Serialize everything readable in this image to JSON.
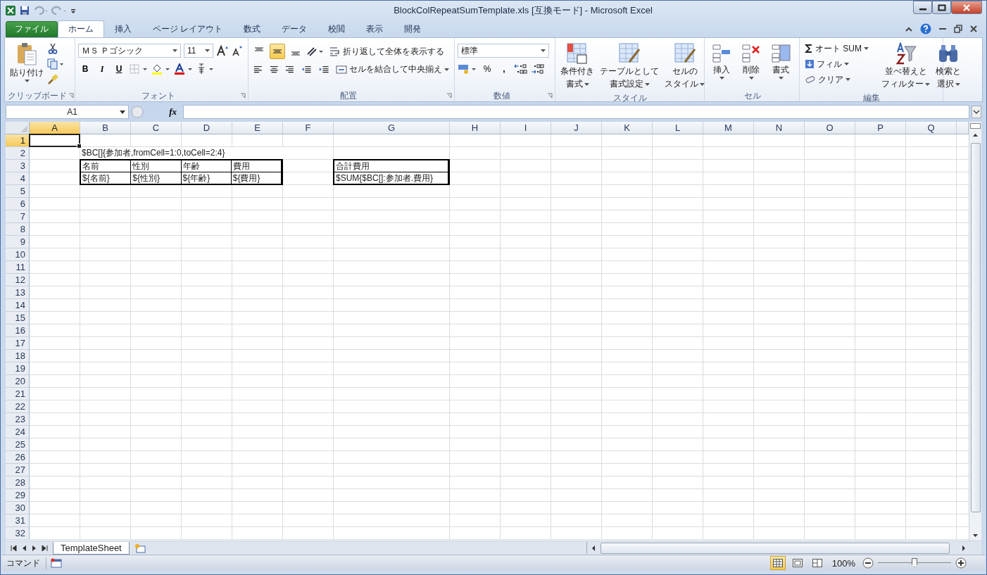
{
  "window": {
    "title": "BlockColRepeatSumTemplate.xls  [互換モード] - Microsoft Excel"
  },
  "tabs": [
    {
      "label": "ファイル",
      "kind": "file",
      "selected": false
    },
    {
      "label": "ホーム",
      "kind": "tab",
      "selected": true
    },
    {
      "label": "挿入",
      "kind": "tab",
      "selected": false
    },
    {
      "label": "ページ レイアウト",
      "kind": "tab",
      "selected": false
    },
    {
      "label": "数式",
      "kind": "tab",
      "selected": false
    },
    {
      "label": "データ",
      "kind": "tab",
      "selected": false
    },
    {
      "label": "校閲",
      "kind": "tab",
      "selected": false
    },
    {
      "label": "表示",
      "kind": "tab",
      "selected": false
    },
    {
      "label": "開発",
      "kind": "tab",
      "selected": false
    }
  ],
  "clipboard": {
    "paste": "貼り付け",
    "label": "クリップボード"
  },
  "font": {
    "name": "ＭＳ Ｐゴシック",
    "size": "11",
    "styles": [
      "B",
      "I",
      "U"
    ],
    "label": "フォント"
  },
  "alignment": {
    "vertical": [
      {
        "selected": false
      },
      {
        "selected": true
      },
      {
        "selected": false
      }
    ],
    "wrap": "折り返して全体を表示する",
    "merge": "セルを結合して中央揃え",
    "label": "配置"
  },
  "number": {
    "format": "標準",
    "percent": "%",
    "comma": ",",
    "label": "数値"
  },
  "styles": {
    "items": [
      [
        "条件付き",
        "書式"
      ],
      [
        "テーブルとして",
        "書式設定"
      ],
      [
        "セルの",
        "スタイル"
      ]
    ],
    "label": "スタイル"
  },
  "cells": {
    "items": [
      "挿入",
      "削除",
      "書式"
    ],
    "label": "セル"
  },
  "editing": {
    "autosum": "オート SUM",
    "fill": "フィル",
    "clear": "クリア",
    "sort": [
      "並べ替えと",
      "フィルター"
    ],
    "find": [
      "検索と",
      "選択"
    ],
    "label": "編集"
  },
  "formula_bar": {
    "name_box": "A1",
    "fx": "fx"
  },
  "sheet": {
    "columns": [
      {
        "label": "A",
        "selected": true
      },
      {
        "label": "B",
        "selected": false
      },
      {
        "label": "C",
        "selected": false
      },
      {
        "label": "D",
        "selected": false
      },
      {
        "label": "E",
        "selected": false
      },
      {
        "label": "F",
        "selected": false
      },
      {
        "label": "G",
        "selected": false
      },
      {
        "label": "H",
        "selected": false
      },
      {
        "label": "I",
        "selected": false
      },
      {
        "label": "J",
        "selected": false
      },
      {
        "label": "K",
        "selected": false
      },
      {
        "label": "L",
        "selected": false
      },
      {
        "label": "M",
        "selected": false
      },
      {
        "label": "N",
        "selected": false
      },
      {
        "label": "O",
        "selected": false
      },
      {
        "label": "P",
        "selected": false
      },
      {
        "label": "Q",
        "selected": false
      }
    ],
    "rows": [
      {
        "label": "1",
        "selected": true
      },
      {
        "label": "2",
        "selected": false
      },
      {
        "label": "3",
        "selected": false
      },
      {
        "label": "4",
        "selected": false
      },
      {
        "label": "5",
        "selected": false
      },
      {
        "label": "6",
        "selected": false
      },
      {
        "label": "7",
        "selected": false
      },
      {
        "label": "8",
        "selected": false
      },
      {
        "label": "9",
        "selected": false
      },
      {
        "label": "10",
        "selected": false
      },
      {
        "label": "11",
        "selected": false
      },
      {
        "label": "12",
        "selected": false
      },
      {
        "label": "13",
        "selected": false
      },
      {
        "label": "14",
        "selected": false
      },
      {
        "label": "15",
        "selected": false
      },
      {
        "label": "16",
        "selected": false
      },
      {
        "label": "17",
        "selected": false
      },
      {
        "label": "18",
        "selected": false
      },
      {
        "label": "19",
        "selected": false
      },
      {
        "label": "20",
        "selected": false
      },
      {
        "label": "21",
        "selected": false
      },
      {
        "label": "22",
        "selected": false
      },
      {
        "label": "23",
        "selected": false
      },
      {
        "label": "24",
        "selected": false
      },
      {
        "label": "25",
        "selected": false
      },
      {
        "label": "26",
        "selected": false
      },
      {
        "label": "27",
        "selected": false
      },
      {
        "label": "28",
        "selected": false
      },
      {
        "label": "29",
        "selected": false
      },
      {
        "label": "30",
        "selected": false
      },
      {
        "label": "31",
        "selected": false
      },
      {
        "label": "32",
        "selected": false
      }
    ],
    "block_tag": "$BC[]{参加者,fromCell=1:0,toCell=2:4}",
    "block_table": {
      "header": [
        "名前",
        "性別",
        "年齢",
        "費用"
      ],
      "row": [
        "${名前}",
        "${性別}",
        "${年齢}",
        "${費用}"
      ]
    },
    "sum_table": {
      "header": "合計費用",
      "row": "$SUM{$BC[]:参加者.費用}"
    }
  },
  "sheet_tabs": [
    {
      "label": "TemplateSheet",
      "selected": true
    }
  ],
  "status_bar": {
    "mode": "コマンド",
    "views": [
      {
        "selected": true
      },
      {
        "selected": false
      },
      {
        "selected": false
      }
    ],
    "zoom": "100%",
    "zoom_slider": {
      "level": 0.5
    }
  }
}
